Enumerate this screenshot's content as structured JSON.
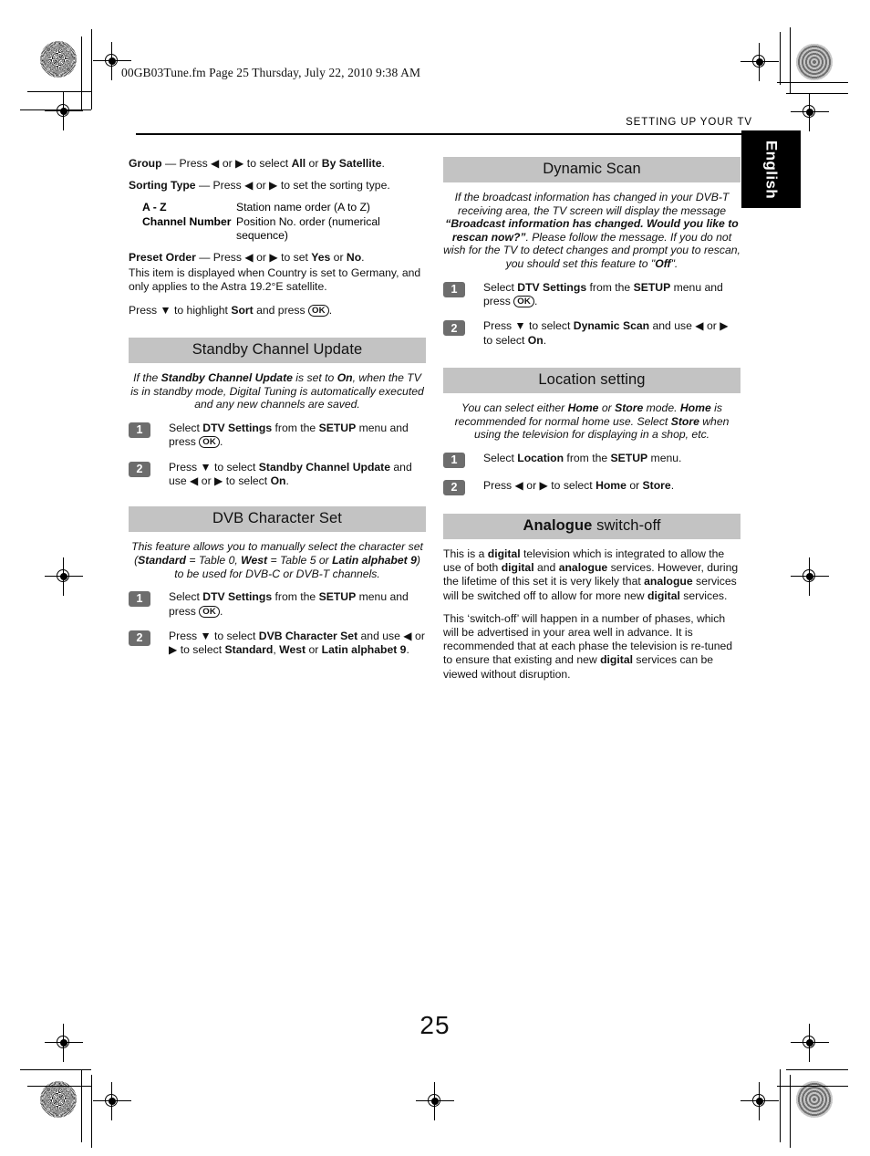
{
  "header": {
    "file_info": "00GB03Tune.fm  Page 25  Thursday, July 22, 2010  9:38 AM",
    "running_head": "SETTING UP YOUR TV",
    "language_tab": "English"
  },
  "page_number": "25",
  "left_column": {
    "group_line": {
      "term": "Group",
      "text": " — Press ◀ or ▶ to select ",
      "opt1": "All",
      "mid": " or ",
      "opt2": "By Satellite",
      "end": "."
    },
    "sorting_line": {
      "term": "Sorting Type",
      "text": " — Press ◀ or ▶ to set the sorting type."
    },
    "sorting_options": [
      {
        "term": "A - Z",
        "desc": "Station name order (A to Z)"
      },
      {
        "term": "Channel Number",
        "desc": "Position No. order (numerical sequence)"
      }
    ],
    "preset_line": {
      "term": "Preset Order",
      "text": " — Press ◀ or ▶ to set ",
      "opt1": "Yes",
      "mid": " or ",
      "opt2": "No",
      "end": "."
    },
    "preset_note": "This item is displayed when Country is set to Germany, and only applies to the Astra 19.2°E satellite.",
    "sort_press": {
      "pre": "Press ▼ to highlight ",
      "bold": "Sort",
      "post": " and press ",
      "ok": "OK",
      "end": "."
    },
    "sections": [
      {
        "title": "Standby Channel Update",
        "intro_parts": [
          {
            "t": "If the ",
            "b": false
          },
          {
            "t": "Standby Channel Update",
            "b": true
          },
          {
            "t": " is set to ",
            "b": false
          },
          {
            "t": "On",
            "b": true
          },
          {
            "t": ", when the TV is in standby mode, Digital Tuning is automatically executed and any new channels are saved.",
            "b": false
          }
        ],
        "steps": [
          {
            "num": "1",
            "parts": [
              {
                "t": "Select ",
                "b": false
              },
              {
                "t": "DTV Settings",
                "b": true
              },
              {
                "t": " from the ",
                "b": false
              },
              {
                "t": "SETUP",
                "b": true
              },
              {
                "t": " menu and press ",
                "b": false
              },
              {
                "t": "OK",
                "ok": true
              },
              {
                "t": ".",
                "b": false
              }
            ]
          },
          {
            "num": "2",
            "parts": [
              {
                "t": "Press ▼ to select ",
                "b": false
              },
              {
                "t": "Standby Channel Update",
                "b": true
              },
              {
                "t": " and use ◀ or ▶ to select ",
                "b": false
              },
              {
                "t": "On",
                "b": true
              },
              {
                "t": ".",
                "b": false
              }
            ]
          }
        ]
      },
      {
        "title": "DVB Character Set",
        "intro_parts": [
          {
            "t": "This feature allows you to manually select the character set (",
            "b": false
          },
          {
            "t": "Standard",
            "b": true
          },
          {
            "t": " = Table 0,  ",
            "b": false
          },
          {
            "t": "West",
            "b": true
          },
          {
            "t": " = Table 5  or ",
            "b": false
          },
          {
            "t": "Latin alphabet 9",
            "b": true
          },
          {
            "t": ") to be used for DVB-C or DVB-T channels.",
            "b": false
          }
        ],
        "steps": [
          {
            "num": "1",
            "parts": [
              {
                "t": "Select ",
                "b": false
              },
              {
                "t": "DTV Settings",
                "b": true
              },
              {
                "t": " from the ",
                "b": false
              },
              {
                "t": "SETUP",
                "b": true
              },
              {
                "t": " menu and press ",
                "b": false
              },
              {
                "t": "OK",
                "ok": true
              },
              {
                "t": ".",
                "b": false
              }
            ]
          },
          {
            "num": "2",
            "parts": [
              {
                "t": "Press ▼ to select ",
                "b": false
              },
              {
                "t": "DVB Character Set",
                "b": true
              },
              {
                "t": " and use ◀ or ▶ to select ",
                "b": false
              },
              {
                "t": "Standard",
                "b": true
              },
              {
                "t": ", ",
                "b": false
              },
              {
                "t": "West",
                "b": true
              },
              {
                "t": " or ",
                "b": false
              },
              {
                "t": "Latin alphabet 9",
                "b": true
              },
              {
                "t": ".",
                "b": false
              }
            ]
          }
        ]
      }
    ]
  },
  "right_column": {
    "sections": [
      {
        "title": "Dynamic Scan",
        "title_bold_prefix": "",
        "intro_parts": [
          {
            "t": "If the broadcast information has changed in your DVB-T receiving area, the TV screen will display the message ",
            "b": false
          },
          {
            "t": "“Broadcast information has changed. Would you like to rescan now?”",
            "b": true
          },
          {
            "t": ". Please follow the message. If you do not wish for the TV to detect changes and prompt you to rescan, you should set this feature to \"",
            "b": false
          },
          {
            "t": "Off",
            "b": true
          },
          {
            "t": "\".",
            "b": false
          }
        ],
        "steps": [
          {
            "num": "1",
            "parts": [
              {
                "t": "Select ",
                "b": false
              },
              {
                "t": "DTV Settings",
                "b": true
              },
              {
                "t": " from the ",
                "b": false
              },
              {
                "t": "SETUP",
                "b": true
              },
              {
                "t": " menu and press ",
                "b": false
              },
              {
                "t": "OK",
                "ok": true
              },
              {
                "t": ".",
                "b": false
              }
            ]
          },
          {
            "num": "2",
            "parts": [
              {
                "t": "Press ▼ to select ",
                "b": false
              },
              {
                "t": "Dynamic Scan",
                "b": true
              },
              {
                "t": " and use ◀ or ▶ to select ",
                "b": false
              },
              {
                "t": "On",
                "b": true
              },
              {
                "t": ".",
                "b": false
              }
            ]
          }
        ]
      },
      {
        "title": "Location setting",
        "title_bold_prefix": "",
        "intro_parts": [
          {
            "t": "You can select either ",
            "b": false
          },
          {
            "t": "Home",
            "b": true
          },
          {
            "t": " or ",
            "b": false
          },
          {
            "t": "Store",
            "b": true
          },
          {
            "t": " mode. ",
            "b": false
          },
          {
            "t": "Home",
            "b": true
          },
          {
            "t": " is recommended for normal home use. Select ",
            "b": false
          },
          {
            "t": "Store",
            "b": true
          },
          {
            "t": " when using the television for displaying in a shop, etc.",
            "b": false
          }
        ],
        "steps": [
          {
            "num": "1",
            "parts": [
              {
                "t": "Select ",
                "b": false
              },
              {
                "t": "Location",
                "b": true
              },
              {
                "t": " from the ",
                "b": false
              },
              {
                "t": "SETUP",
                "b": true
              },
              {
                "t": " menu.",
                "b": false
              }
            ]
          },
          {
            "num": "2",
            "parts": [
              {
                "t": "Press ◀ or ▶ to select ",
                "b": false
              },
              {
                "t": "Home",
                "b": true
              },
              {
                "t": " or ",
                "b": false
              },
              {
                "t": "Store",
                "b": true
              },
              {
                "t": ".",
                "b": false
              }
            ]
          }
        ]
      },
      {
        "title": "switch-off",
        "title_bold_prefix": "Analogue",
        "paragraphs": [
          [
            {
              "t": "This is a ",
              "b": false
            },
            {
              "t": "digital",
              "b": true
            },
            {
              "t": " television which is integrated to allow the use of both ",
              "b": false
            },
            {
              "t": "digital",
              "b": true
            },
            {
              "t": " and ",
              "b": false
            },
            {
              "t": "analogue",
              "b": true
            },
            {
              "t": " services. However, during the lifetime of this set it is very likely that ",
              "b": false
            },
            {
              "t": "analogue",
              "b": true
            },
            {
              "t": " services will be switched off to allow for more new ",
              "b": false
            },
            {
              "t": "digital",
              "b": true
            },
            {
              "t": " services.",
              "b": false
            }
          ],
          [
            {
              "t": "This ‘switch-off’ will happen in a number of phases, which will be advertised in your area well in advance. It is recommended that at each phase the television is re-tuned to ensure that existing and new ",
              "b": false
            },
            {
              "t": "digital",
              "b": true
            },
            {
              "t": " services can be viewed without disruption.",
              "b": false
            }
          ]
        ]
      }
    ]
  },
  "colors": {
    "section_bar": "#c3c3c3",
    "step_badge": "#6d6d6d",
    "language_tab": "#000000"
  }
}
